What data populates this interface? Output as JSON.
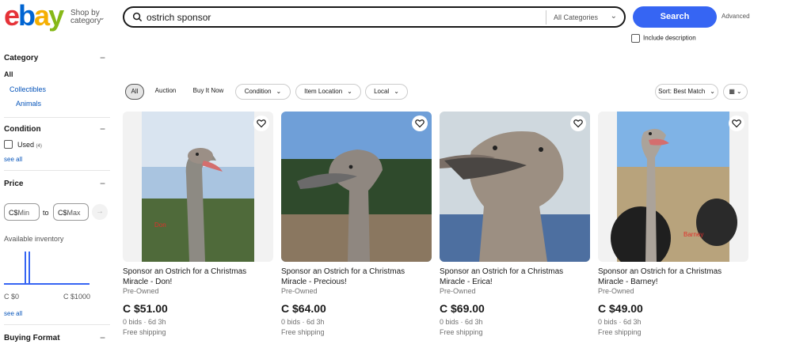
{
  "header": {
    "logo": "ebay",
    "shop_by": "Shop by",
    "category": "category",
    "search_value": "ostrich sponsor",
    "category_select": "All Categories",
    "search_button": "Search",
    "advanced": "Advanced",
    "include_description": "Include description"
  },
  "sidebar": {
    "category_title": "Category",
    "all": "All",
    "collectibles": "Collectibles",
    "animals": "Animals",
    "condition_title": "Condition",
    "used": "Used",
    "used_count": "(4)",
    "see_all": "see all",
    "price_title": "Price",
    "min_currency": "C$",
    "min_placeholder": "Min",
    "to": "to",
    "max_currency": "C$",
    "max_placeholder": "Max",
    "go_icon": "arrow-right-icon",
    "available_inventory": "Available inventory",
    "range_min": "C $0",
    "range_max": "C $1000",
    "see_all_2": "see all",
    "buying_format_title": "Buying Format"
  },
  "filters": {
    "all": "All",
    "auction": "Auction",
    "buy_it_now": "Buy It Now",
    "condition": "Condition",
    "item_location": "Item Location",
    "local": "Local",
    "sort": "Sort: Best Match"
  },
  "listings": [
    {
      "title": "Sponsor an Ostrich for a Christmas Miracle - Don!",
      "condition": "Pre-Owned",
      "price": "C $51.00",
      "bids": "0 bids · 6d 3h",
      "shipping": "Free shipping",
      "name_tag": "Don"
    },
    {
      "title": "Sponsor an Ostrich for a Christmas Miracle - Precious!",
      "condition": "Pre-Owned",
      "price": "C $64.00",
      "bids": "0 bids · 6d 3h",
      "shipping": "Free shipping",
      "name_tag": ""
    },
    {
      "title": "Sponsor an Ostrich for a Christmas Miracle - Erica!",
      "condition": "Pre-Owned",
      "price": "C $69.00",
      "bids": "0 bids · 6d 3h",
      "shipping": "Free shipping",
      "name_tag": ""
    },
    {
      "title": "Sponsor an Ostrich for a Christmas Miracle - Barney!",
      "condition": "Pre-Owned",
      "price": "C $49.00",
      "bids": "0 bids · 6d 3h",
      "shipping": "Free shipping",
      "name_tag": "Barney"
    }
  ],
  "colors": {
    "accent": "#3665f3",
    "link": "#0654ba"
  }
}
